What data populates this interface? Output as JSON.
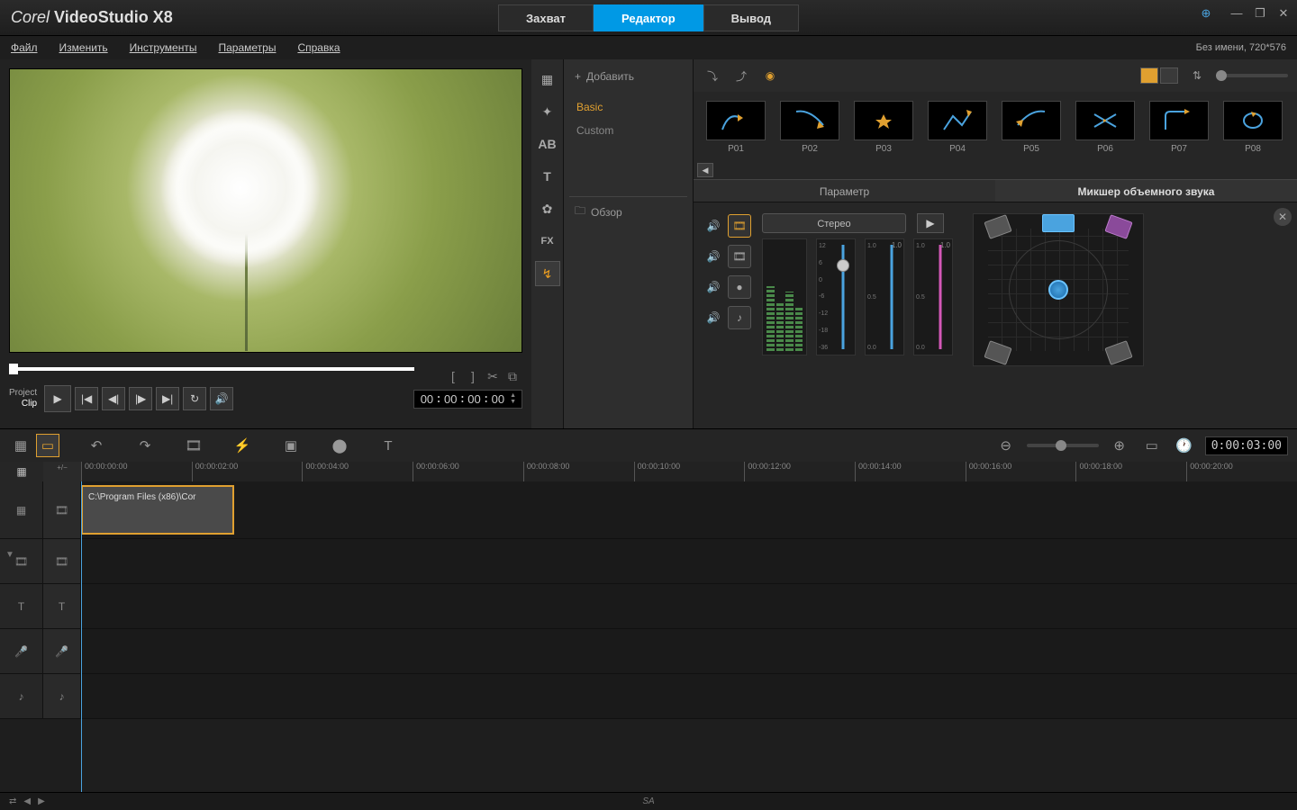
{
  "app": {
    "brand": "Corel",
    "product": "VideoStudio",
    "version": "X8"
  },
  "modes": {
    "capture": "Захват",
    "editor": "Редактор",
    "output": "Вывод",
    "active": "editor"
  },
  "menu": {
    "file": "Файл",
    "edit": "Изменить",
    "tools": "Инструменты",
    "params": "Параметры",
    "help": "Справка"
  },
  "project": {
    "info": "Без имени, 720*576"
  },
  "preview": {
    "project_label": "Project",
    "clip_label": "Clip",
    "timecode": {
      "h": "00",
      "m": "00",
      "s": "00",
      "f": "00"
    }
  },
  "library": {
    "add": "Добавить",
    "items": [
      {
        "label": "Basic",
        "active": true
      },
      {
        "label": "Custom",
        "active": false
      }
    ],
    "browse": "Обзор"
  },
  "presets": [
    {
      "id": "P01"
    },
    {
      "id": "P02"
    },
    {
      "id": "P03"
    },
    {
      "id": "P04"
    },
    {
      "id": "P05"
    },
    {
      "id": "P06"
    },
    {
      "id": "P07"
    },
    {
      "id": "P08"
    }
  ],
  "option_tabs": {
    "param": "Параметр",
    "mixer": "Микшер объемного звука",
    "active": "mixer"
  },
  "mixer": {
    "stereo": "Стерео",
    "scale1": [
      "12",
      "6",
      "0",
      "-6",
      "-12",
      "-18",
      "-36"
    ],
    "scale2": [
      "1.0",
      "0.5",
      "0.0"
    ],
    "val2": "1.0",
    "val3": "1.0"
  },
  "timeline": {
    "marks": [
      "00:00:00:00",
      "00:00:02:00",
      "00:00:04:00",
      "00:00:06:00",
      "00:00:08:00",
      "00:00:10:00",
      "00:00:12:00",
      "00:00:14:00",
      "00:00:16:00",
      "00:00:18:00",
      "00:00:20:00"
    ],
    "timecode": "0:00:03:00",
    "clip_label": "C:\\Program Files (x86)\\Cor"
  },
  "status": {
    "center": "SA"
  }
}
